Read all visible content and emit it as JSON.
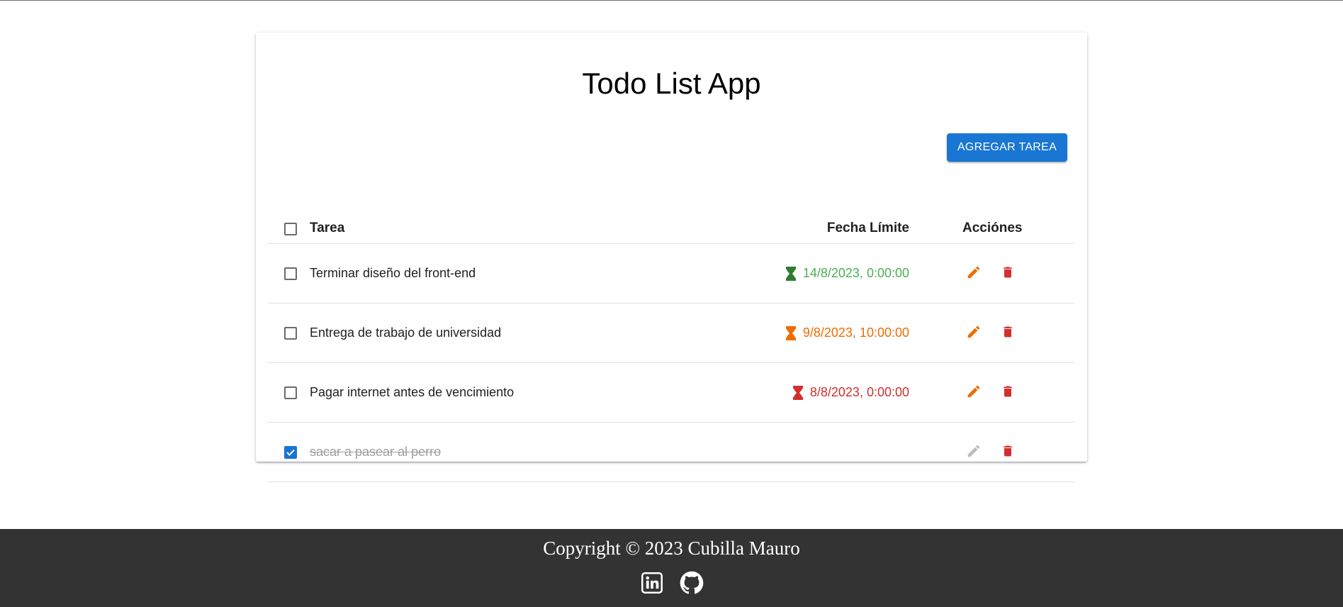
{
  "app": {
    "title": "Todo List App",
    "add_button_label": "AGREGAR TAREA"
  },
  "table": {
    "headers": {
      "task": "Tarea",
      "deadline": "Fecha Límite",
      "actions": "Acciónes"
    },
    "rows": [
      {
        "task": "Terminar diseño del front-end",
        "deadline": "14/8/2023, 0:00:00",
        "status_color": "#4caf50",
        "icon_color": "#2e7d32",
        "completed": false
      },
      {
        "task": "Entrega de trabajo de universidad",
        "deadline": "9/8/2023, 10:00:00",
        "status_color": "#ef6c00",
        "icon_color": "#ef6c00",
        "completed": false
      },
      {
        "task": "Pagar internet antes de vencimiento",
        "deadline": "8/8/2023, 0:00:00",
        "status_color": "#d32f2f",
        "icon_color": "#d32f2f",
        "completed": false
      },
      {
        "task": "sacar a pasear al perro",
        "deadline": "",
        "status_color": "#9e9e9e",
        "icon_color": "",
        "completed": true
      }
    ]
  },
  "colors": {
    "primary": "#1976d2",
    "edit": "#ef6c00",
    "edit_disabled": "#bdbdbd",
    "delete": "#d32f2f",
    "footer_bg": "#333333"
  },
  "icons": {
    "edit": "pencil-icon",
    "delete": "trash-icon",
    "deadline": "hourglass-icon",
    "social": [
      "linkedin-icon",
      "github-icon"
    ]
  },
  "footer": {
    "copyright": "Copyright © 2023 Cubilla Mauro"
  }
}
